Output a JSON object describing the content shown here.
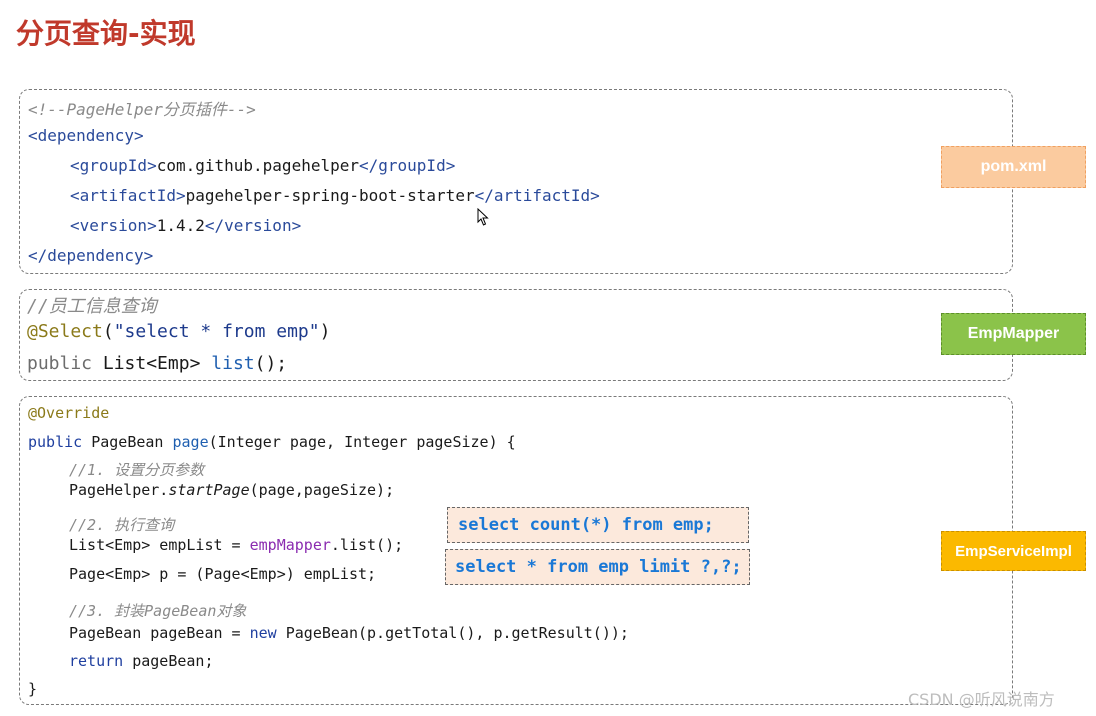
{
  "title": "分页查询-实现",
  "pom": {
    "comment": "<!--PageHelper分页插件-->",
    "dep_open": "<dependency>",
    "group_open": "<groupId>",
    "group_value": "com.github.pagehelper",
    "group_close": "</groupId>",
    "artifact_open": "<artifactId>",
    "artifact_value": "pagehelper-spring-boot-starter",
    "artifact_close": "</artifactId>",
    "version_open": "<version>",
    "version_value": "1.4.2",
    "version_close": "</version>",
    "dep_close": "</dependency>"
  },
  "mapper": {
    "comment": "//员工信息查询",
    "annotation": "@Select",
    "paren_open": "(",
    "query": "\"select * from emp\"",
    "paren_close": ")",
    "kw_public": "public",
    "return_type": "List<Emp>",
    "method": "list",
    "method_tail": "();"
  },
  "service": {
    "annotation": "@Override",
    "sig_public": "public",
    "sig_type": "PageBean",
    "sig_method": "page",
    "sig_params": "(Integer page, Integer pageSize) {",
    "c1": "//1. 设置分页参数",
    "l1_a": "PageHelper.",
    "l1_b": "startPage",
    "l1_c": "(page,pageSize);",
    "c2": "//2. 执行查询",
    "l2_a": "List<Emp> empList = ",
    "l2_b": "empMapper",
    "l2_c": ".list();",
    "l3": "Page<Emp> p = (Page<Emp>) empList;",
    "c3": "//3. 封装PageBean对象",
    "l4_a": "PageBean pageBean = ",
    "l4_kw": "new",
    "l4_b": " PageBean(p.getTotal(), p.getResult());",
    "l5_kw": "return",
    "l5_b": " pageBean;",
    "close": "}",
    "sql_count": "select count(*) from emp;",
    "sql_limit": "select * from emp limit ?,?;"
  },
  "labels": {
    "pom": "pom.xml",
    "mapper": "EmpMapper",
    "service": "EmpServiceImpl"
  },
  "watermark": "CSDN @听风说南方",
  "colors": {
    "title": "#c0392b",
    "pom_label": "#fbcb9f",
    "mapper_label": "#8bc34a",
    "service_label": "#fbb900",
    "sql_text": "#1a78d6",
    "sql_bg": "#fce9dc"
  }
}
